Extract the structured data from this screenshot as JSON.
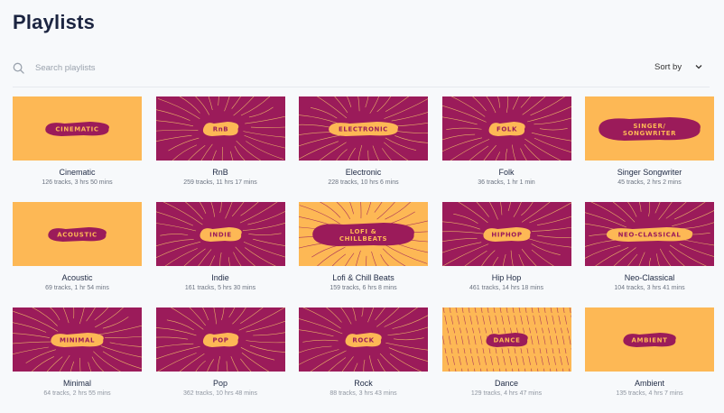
{
  "header": {
    "title": "Playlists"
  },
  "search": {
    "placeholder": "Search playlists",
    "icon": "search-icon"
  },
  "sort": {
    "label": "Sort by",
    "icon": "chevron-down-icon"
  },
  "colors": {
    "yellow": "#fdb855",
    "magenta": "#9b1b5a",
    "line_on_magenta": "#f5c86a",
    "line_on_yellow": "#9b1b5a"
  },
  "playlists": [
    {
      "cover_text": "CINEMATIC",
      "name": "Cinematic",
      "meta": "126 tracks, 3 hrs 50 mins",
      "theme": "yellow",
      "style": "plain"
    },
    {
      "cover_text": "RnB",
      "name": "RnB",
      "meta": "259 tracks, 11 hrs 17 mins",
      "theme": "magenta",
      "style": "burst"
    },
    {
      "cover_text": "ELECTRONIC",
      "name": "Electronic",
      "meta": "228 tracks, 10 hrs 6 mins",
      "theme": "magenta",
      "style": "burst"
    },
    {
      "cover_text": "FOLK",
      "name": "Folk",
      "meta": "36 tracks, 1 hr 1 min",
      "theme": "magenta",
      "style": "burst"
    },
    {
      "cover_text": "SINGER/ SONGWRITER",
      "name": "Singer Songwriter",
      "meta": "45 tracks, 2 hrs 2 mins",
      "theme": "yellow",
      "style": "plain"
    },
    {
      "cover_text": "ACOUSTIC",
      "name": "Acoustic",
      "meta": "69 tracks, 1 hr 54 mins",
      "theme": "yellow",
      "style": "plain"
    },
    {
      "cover_text": "INDIE",
      "name": "Indie",
      "meta": "161 tracks, 5 hrs 30 mins",
      "theme": "magenta",
      "style": "burst"
    },
    {
      "cover_text": "LOFI & CHILLBEATS",
      "name": "Lofi & Chill Beats",
      "meta": "159 tracks, 6 hrs 8 mins",
      "theme": "yellow",
      "style": "burst"
    },
    {
      "cover_text": "HIPHOP",
      "name": "Hip Hop",
      "meta": "461 tracks, 14 hrs 18 mins",
      "theme": "magenta",
      "style": "burst"
    },
    {
      "cover_text": "NEO-CLASSICAL",
      "name": "Neo-Classical",
      "meta": "104 tracks, 3 hrs 41 mins",
      "theme": "magenta",
      "style": "burst"
    },
    {
      "cover_text": "MINIMAL",
      "name": "Minimal",
      "meta": "64 tracks, 2 hrs 55 mins",
      "theme": "magenta",
      "style": "burst"
    },
    {
      "cover_text": "POP",
      "name": "Pop",
      "meta": "362 tracks, 10 hrs 48 mins",
      "theme": "magenta",
      "style": "burst"
    },
    {
      "cover_text": "ROCK",
      "name": "Rock",
      "meta": "88 tracks, 3 hrs 43 mins",
      "theme": "magenta",
      "style": "burst"
    },
    {
      "cover_text": "DANCE",
      "name": "Dance",
      "meta": "129 tracks, 4 hrs 47 mins",
      "theme": "yellow",
      "style": "hatch"
    },
    {
      "cover_text": "AMBIENT",
      "name": "Ambient",
      "meta": "135 tracks, 4 hrs 7 mins",
      "theme": "yellow",
      "style": "plain"
    }
  ]
}
